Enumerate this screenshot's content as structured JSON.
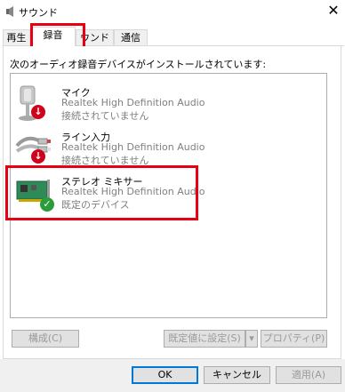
{
  "window": {
    "title": "サウンド",
    "close": "✕",
    "speaker_icon": "speaker-icon",
    "close_icon": "close-icon"
  },
  "tabs": [
    {
      "label": "再生",
      "active": false
    },
    {
      "label": "録音",
      "active": true
    },
    {
      "label": "ウンド",
      "active": false
    },
    {
      "label": "通信",
      "active": false
    }
  ],
  "recording": {
    "instruction": "次のオーディオ録音デバイスがインストールされています:",
    "devices": [
      {
        "name": "マイク",
        "driver": "Realtek High Definition Audio",
        "status": "接続されていません",
        "icon": "microphone-icon",
        "status_icon": "disconnected-icon"
      },
      {
        "name": "ライン入力",
        "driver": "Realtek High Definition Audio",
        "status": "接続されていません",
        "icon": "line-in-icon",
        "status_icon": "disconnected-icon"
      },
      {
        "name": "ステレオ ミキサー",
        "driver": "Realtek High Definition Audio",
        "status": "既定のデバイス",
        "icon": "sound-card-icon",
        "status_icon": "default-check-icon"
      }
    ],
    "configure": "構成(C)",
    "set_default": "既定値に設定(S)",
    "properties": "プロパティ(P)"
  },
  "footer": {
    "ok": "OK",
    "cancel": "キャンセル",
    "apply": "適用(A)"
  },
  "colors": {
    "highlight_red": "#e60012",
    "check_green": "#2a9d3a",
    "down_red": "#d0021b",
    "pcb_green": "#2e8b57"
  }
}
